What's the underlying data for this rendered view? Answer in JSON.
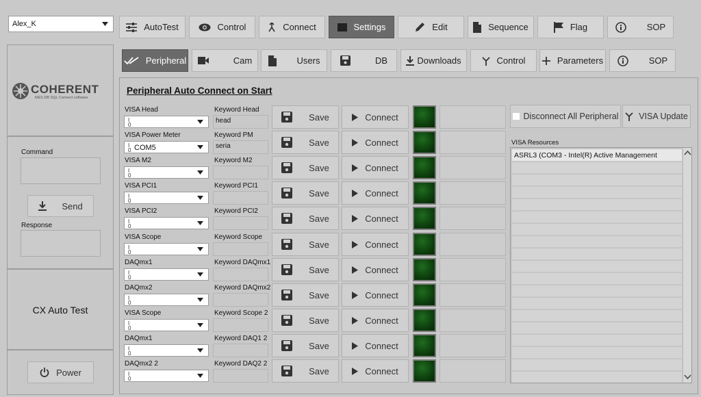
{
  "user_select": {
    "value": "Alex_K"
  },
  "top_tabs": [
    {
      "label": "AutoTest",
      "icon": "sliders-icon"
    },
    {
      "label": "Control",
      "icon": "eye-icon"
    },
    {
      "label": "Connect",
      "icon": "connect-icon"
    },
    {
      "label": "Settings",
      "icon": "square-icon"
    },
    {
      "label": "Edit",
      "icon": "pencil-icon"
    },
    {
      "label": "Sequence",
      "icon": "document-icon"
    },
    {
      "label": "Flag",
      "icon": "flag-icon"
    },
    {
      "label": "SOP",
      "icon": "info-icon"
    }
  ],
  "sub_tabs": [
    {
      "label": "Peripheral",
      "icon": "checkmarks-icon"
    },
    {
      "label": "Cam",
      "icon": "camera-icon"
    },
    {
      "label": "Users",
      "icon": "document-icon"
    },
    {
      "label": "DB",
      "icon": "save-icon"
    },
    {
      "label": "Downloads",
      "icon": "download-icon"
    },
    {
      "label": "Control",
      "icon": "fork-icon"
    },
    {
      "label": "Parameters",
      "icon": "plus-icon"
    },
    {
      "label": "SOP",
      "icon": "info-icon"
    }
  ],
  "sidebar": {
    "logo_text": "COHERENT",
    "logo_subtitle": "MES DB SQL Connect software",
    "command_label": "Command",
    "command_value": "",
    "send_label": "Send",
    "response_label": "Response",
    "response_value": "",
    "app_name": "CX Auto Test",
    "power_label": "Power"
  },
  "section_title": "Peripheral Auto Connect on Start",
  "save_label": "Save",
  "connect_label": "Connect",
  "rows": [
    {
      "visa_label": "VISA Head",
      "visa_value": "",
      "kw_label": "Keyword Head",
      "kw_value": "head"
    },
    {
      "visa_label": "VISA Power Meter",
      "visa_value": "COM5",
      "kw_label": "Keyword PM",
      "kw_value": "seria"
    },
    {
      "visa_label": "VISA M2",
      "visa_value": "",
      "kw_label": "Keyword M2",
      "kw_value": ""
    },
    {
      "visa_label": "VISA PCI1",
      "visa_value": "",
      "kw_label": "Keyword PCI1",
      "kw_value": ""
    },
    {
      "visa_label": "VISA PCI2",
      "visa_value": "",
      "kw_label": "Keyword PCI2",
      "kw_value": ""
    },
    {
      "visa_label": "VISA Scope",
      "visa_value": "",
      "kw_label": "Keyword Scope",
      "kw_value": ""
    },
    {
      "visa_label": "DAQmx1",
      "visa_value": "",
      "kw_label": "Keyword DAQmx1",
      "kw_value": ""
    },
    {
      "visa_label": "DAQmx2",
      "visa_value": "",
      "kw_label": "Keyword DAQmx2",
      "kw_value": ""
    },
    {
      "visa_label": "VISA Scope",
      "visa_value": "",
      "kw_label": "Keyword Scope 2",
      "kw_value": ""
    },
    {
      "visa_label": "DAQmx1",
      "visa_value": "",
      "kw_label": "Keyword DAQ1 2",
      "kw_value": ""
    },
    {
      "visa_label": "DAQmx2 2",
      "visa_value": "",
      "kw_label": "Keyword DAQ2 2",
      "kw_value": ""
    }
  ],
  "right_panel": {
    "disconnect_label": "Disconnect All Peripheral",
    "visa_update_label": "VISA Update",
    "resources_label": "VISA Resources",
    "resources": [
      "ASRL3  (COM3 - Intel(R) Active Management"
    ]
  },
  "colors": {
    "active_tab": "#6a6a6a",
    "led_on": "#0d3f0d",
    "background": "#c9c9c9"
  }
}
